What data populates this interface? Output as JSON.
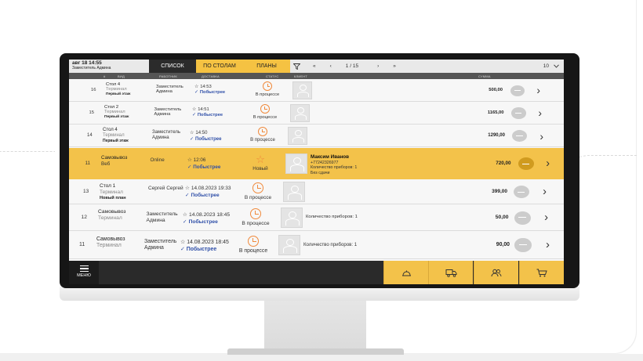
{
  "topbar": {
    "date": "авг 18 14:55",
    "user": "Заместитель Админа",
    "tabs": [
      "СПИСОК",
      "ПО СТОЛАМ",
      "ПЛАНЫ"
    ],
    "first_icon": "«",
    "prev_icon": "‹",
    "page": "1 / 15",
    "next_icon": "›",
    "last_icon": "»",
    "per_page": "10"
  },
  "columns": [
    "#",
    "ВИД",
    "РАБОТНИК",
    "ДОСТАВКА",
    "СТАТУС",
    "КЛИЕНТ",
    "СУММА"
  ],
  "rows": [
    {
      "num": "16",
      "name": "Стол 4",
      "source": "Терминал",
      "place": "Первый этаж",
      "employee": [
        "Заместитель",
        "Админа"
      ],
      "time": "14:53",
      "speed": "Побыстрее",
      "status": "В процессе",
      "client_name": "",
      "client_lines": [],
      "sum": "500,00"
    },
    {
      "num": "15",
      "name": "Стол 2",
      "source": "Терминал",
      "place": "Первый этаж",
      "employee": [
        "Заместитель",
        "Админа"
      ],
      "time": "14:51",
      "speed": "Побыстрее",
      "status": "В процессе",
      "client_name": "",
      "client_lines": [],
      "sum": "1165,00"
    },
    {
      "num": "14",
      "name": "Стол 4",
      "source": "Терминал",
      "place": "Первый этаж",
      "employee": [
        "Заместитель",
        "Админа"
      ],
      "time": "14:50",
      "speed": "Побыстрее",
      "status": "В процессе",
      "client_name": "",
      "client_lines": [],
      "sum": "1290,00"
    },
    {
      "num": "11",
      "name": "Самовывоз",
      "source": "Веб",
      "place": "",
      "employee": [
        "Online",
        ""
      ],
      "time": "12:06",
      "speed": "Побыстрее",
      "status": "Новый",
      "client_name": "Максим Иванов",
      "client_lines": [
        "+77242326977",
        "Количество приборов: 1",
        "Без сдачи"
      ],
      "sum": "720,00"
    },
    {
      "num": "13",
      "name": "Стол 1",
      "source": "Терминал",
      "place": "Новый план",
      "employee": [
        "Сергей Сергей",
        ""
      ],
      "time": "14.08.2023 19:33",
      "speed": "Побыстрее",
      "status": "В процессе",
      "client_name": "",
      "client_lines": [],
      "sum": "399,00"
    },
    {
      "num": "12",
      "name": "Самовывоз",
      "source": "Терминал",
      "place": "",
      "employee": [
        "Заместитель",
        "Админа"
      ],
      "time": "14.08.2023 18:45",
      "speed": "Побыстрее",
      "status": "В процессе",
      "client_name": "",
      "client_lines": [
        "Количество приборов: 1"
      ],
      "sum": "50,00"
    },
    {
      "num": "11",
      "name": "Самовывоз",
      "source": "Терминал",
      "place": "",
      "employee": [
        "Заместитель",
        "Админа"
      ],
      "time": "14.08.2023 18:45",
      "speed": "Побыстрее",
      "status": "В процессе",
      "client_name": "",
      "client_lines": [
        "Количество приборов: 1"
      ],
      "sum": "90,00"
    }
  ],
  "bottombar": {
    "menu_label": "МЕНЮ",
    "actions": [
      "bell-service-icon",
      "delivery-truck-icon",
      "users-icon",
      "cart-icon"
    ]
  },
  "colors": {
    "accent": "#f3c24a",
    "link": "#2f4fa8",
    "status_icon": "#f08a3c"
  }
}
